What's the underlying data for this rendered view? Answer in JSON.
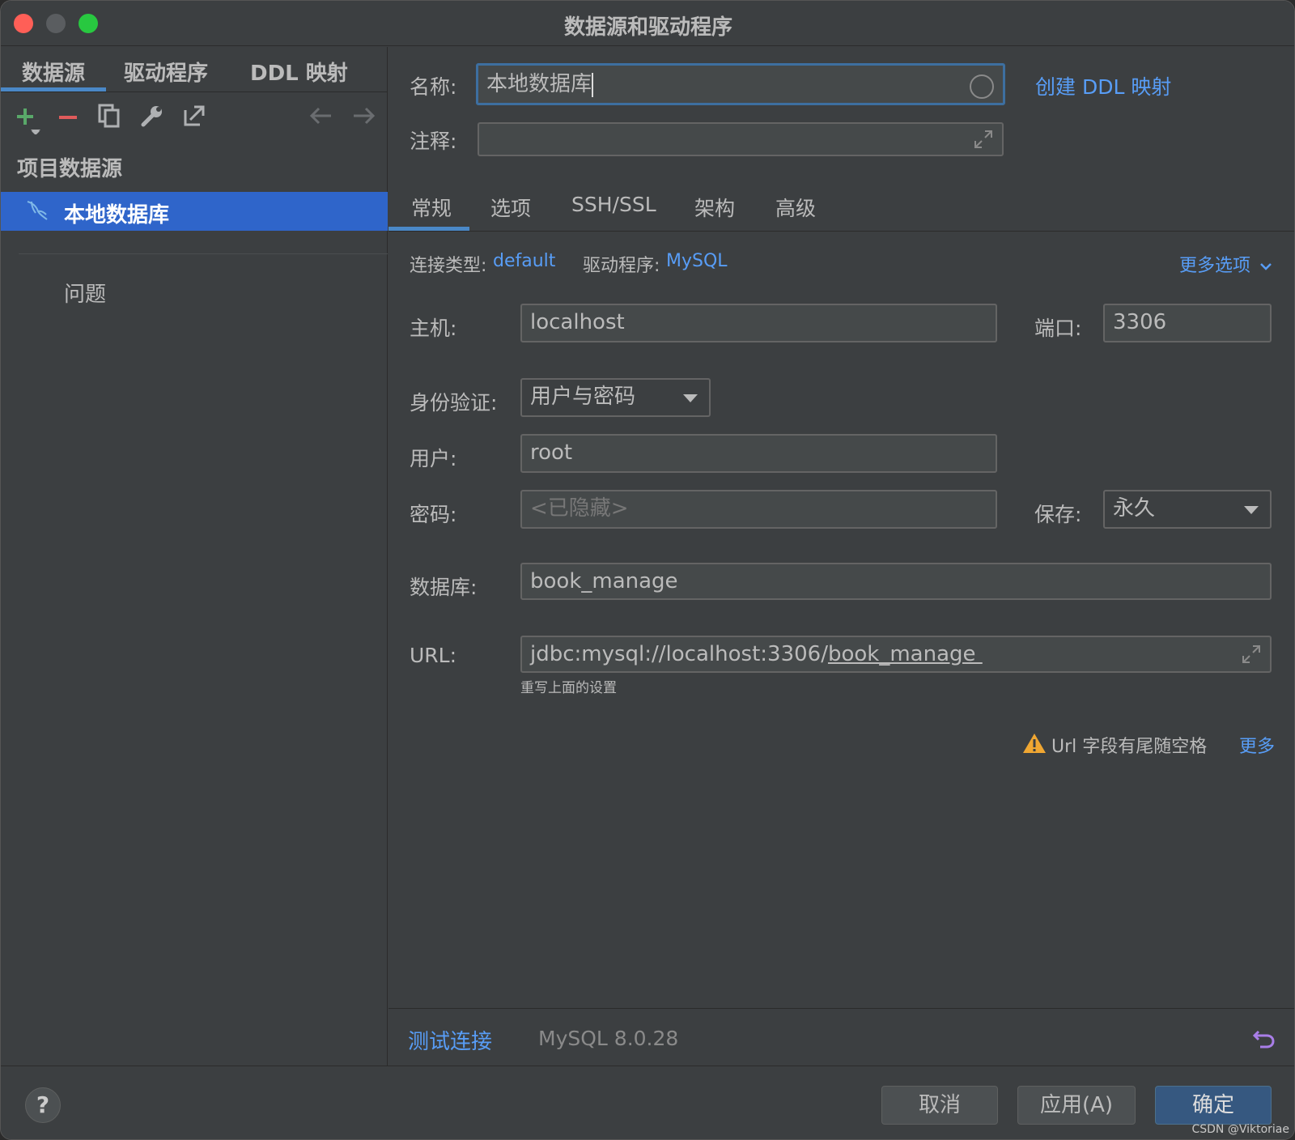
{
  "window": {
    "title": "数据源和驱动程序"
  },
  "left_tabs": [
    "数据源",
    "驱动程序",
    "DDL 映射"
  ],
  "left": {
    "section_title": "项目数据源",
    "selected_item": "本地数据库",
    "problems": "问题"
  },
  "right": {
    "name_label": "名称:",
    "name_value": "本地数据库",
    "create_ddl_link": "创建 DDL 映射",
    "comment_label": "注释:",
    "comment_value": "",
    "tabs": [
      "常规",
      "选项",
      "SSH/SSL",
      "架构",
      "高级"
    ],
    "conn_type_label": "连接类型:",
    "conn_type_value": "default",
    "driver_label": "驱动程序:",
    "driver_value": "MySQL",
    "more_options": "更多选项",
    "host_label": "主机:",
    "host_value": "localhost",
    "port_label": "端口:",
    "port_value": "3306",
    "auth_label": "身份验证:",
    "auth_value": "用户与密码",
    "user_label": "用户:",
    "user_value": "root",
    "password_label": "密码:",
    "password_placeholder": "<已隐藏>",
    "save_label": "保存:",
    "save_value": "永久",
    "database_label": "数据库:",
    "database_value": "book_manage",
    "url_label": "URL:",
    "url_prefix": "jdbc:mysql://localhost:3306/",
    "url_db": "book_manage ",
    "url_hint": "重写上面的设置",
    "warning_text": "Url 字段有尾随空格",
    "warning_more": "更多",
    "test_connection": "测试连接",
    "mysql_version": "MySQL 8.0.28"
  },
  "footer": {
    "help": "?",
    "cancel": "取消",
    "apply": "应用(A)",
    "ok": "确定",
    "watermark": "CSDN @Viktoriae"
  },
  "colors": {
    "accent": "#589df6",
    "selection": "#2f65ca",
    "background": "#3c3f41",
    "field": "#45494a",
    "warning": "#f0a732"
  }
}
